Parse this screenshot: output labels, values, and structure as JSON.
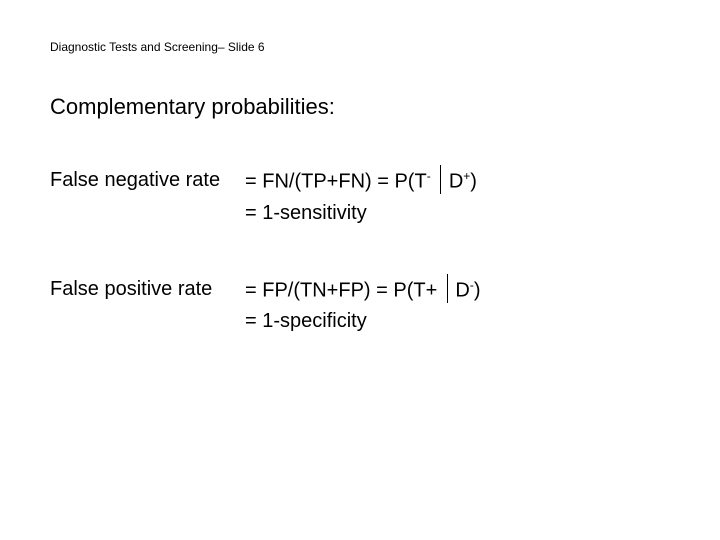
{
  "header": "Diagnostic Tests and Screening– Slide 6",
  "title": "Complementary probabilities:",
  "fnr": {
    "label": "False negative rate",
    "eq1_a": "= FN/(TP+FN) = P(T",
    "eq1_sup1": "-",
    "eq1_b": "D",
    "eq1_sup2": "+",
    "eq1_c": ")",
    "eq2": "= 1-sensitivity"
  },
  "fpr": {
    "label": "False positive rate",
    "eq1_a": "= FP/(TN+FP) = P(T+",
    "eq1_b": "D",
    "eq1_sup2": "-",
    "eq1_c": ")",
    "eq2": "= 1-specificity"
  }
}
